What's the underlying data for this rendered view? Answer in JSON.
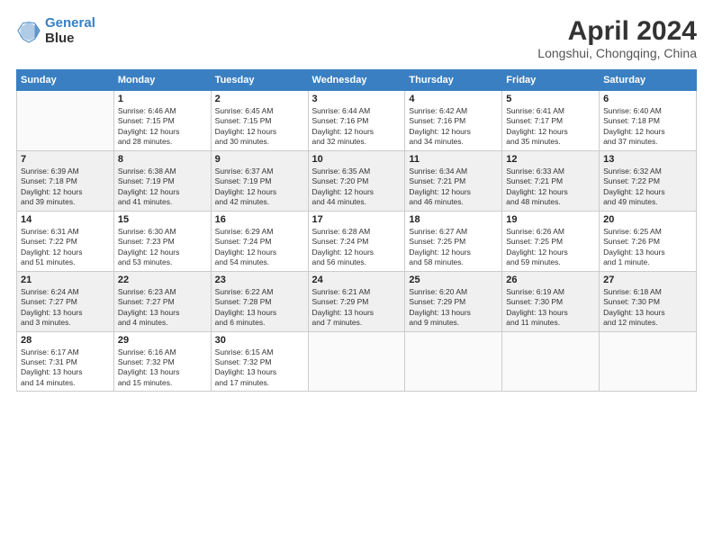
{
  "logo": {
    "line1": "General",
    "line2": "Blue"
  },
  "title": "April 2024",
  "location": "Longshui, Chongqing, China",
  "weekdays": [
    "Sunday",
    "Monday",
    "Tuesday",
    "Wednesday",
    "Thursday",
    "Friday",
    "Saturday"
  ],
  "weeks": [
    [
      {
        "day": "",
        "info": ""
      },
      {
        "day": "1",
        "info": "Sunrise: 6:46 AM\nSunset: 7:15 PM\nDaylight: 12 hours\nand 28 minutes."
      },
      {
        "day": "2",
        "info": "Sunrise: 6:45 AM\nSunset: 7:15 PM\nDaylight: 12 hours\nand 30 minutes."
      },
      {
        "day": "3",
        "info": "Sunrise: 6:44 AM\nSunset: 7:16 PM\nDaylight: 12 hours\nand 32 minutes."
      },
      {
        "day": "4",
        "info": "Sunrise: 6:42 AM\nSunset: 7:16 PM\nDaylight: 12 hours\nand 34 minutes."
      },
      {
        "day": "5",
        "info": "Sunrise: 6:41 AM\nSunset: 7:17 PM\nDaylight: 12 hours\nand 35 minutes."
      },
      {
        "day": "6",
        "info": "Sunrise: 6:40 AM\nSunset: 7:18 PM\nDaylight: 12 hours\nand 37 minutes."
      }
    ],
    [
      {
        "day": "7",
        "info": "Sunrise: 6:39 AM\nSunset: 7:18 PM\nDaylight: 12 hours\nand 39 minutes."
      },
      {
        "day": "8",
        "info": "Sunrise: 6:38 AM\nSunset: 7:19 PM\nDaylight: 12 hours\nand 41 minutes."
      },
      {
        "day": "9",
        "info": "Sunrise: 6:37 AM\nSunset: 7:19 PM\nDaylight: 12 hours\nand 42 minutes."
      },
      {
        "day": "10",
        "info": "Sunrise: 6:35 AM\nSunset: 7:20 PM\nDaylight: 12 hours\nand 44 minutes."
      },
      {
        "day": "11",
        "info": "Sunrise: 6:34 AM\nSunset: 7:21 PM\nDaylight: 12 hours\nand 46 minutes."
      },
      {
        "day": "12",
        "info": "Sunrise: 6:33 AM\nSunset: 7:21 PM\nDaylight: 12 hours\nand 48 minutes."
      },
      {
        "day": "13",
        "info": "Sunrise: 6:32 AM\nSunset: 7:22 PM\nDaylight: 12 hours\nand 49 minutes."
      }
    ],
    [
      {
        "day": "14",
        "info": "Sunrise: 6:31 AM\nSunset: 7:22 PM\nDaylight: 12 hours\nand 51 minutes."
      },
      {
        "day": "15",
        "info": "Sunrise: 6:30 AM\nSunset: 7:23 PM\nDaylight: 12 hours\nand 53 minutes."
      },
      {
        "day": "16",
        "info": "Sunrise: 6:29 AM\nSunset: 7:24 PM\nDaylight: 12 hours\nand 54 minutes."
      },
      {
        "day": "17",
        "info": "Sunrise: 6:28 AM\nSunset: 7:24 PM\nDaylight: 12 hours\nand 56 minutes."
      },
      {
        "day": "18",
        "info": "Sunrise: 6:27 AM\nSunset: 7:25 PM\nDaylight: 12 hours\nand 58 minutes."
      },
      {
        "day": "19",
        "info": "Sunrise: 6:26 AM\nSunset: 7:25 PM\nDaylight: 12 hours\nand 59 minutes."
      },
      {
        "day": "20",
        "info": "Sunrise: 6:25 AM\nSunset: 7:26 PM\nDaylight: 13 hours\nand 1 minute."
      }
    ],
    [
      {
        "day": "21",
        "info": "Sunrise: 6:24 AM\nSunset: 7:27 PM\nDaylight: 13 hours\nand 3 minutes."
      },
      {
        "day": "22",
        "info": "Sunrise: 6:23 AM\nSunset: 7:27 PM\nDaylight: 13 hours\nand 4 minutes."
      },
      {
        "day": "23",
        "info": "Sunrise: 6:22 AM\nSunset: 7:28 PM\nDaylight: 13 hours\nand 6 minutes."
      },
      {
        "day": "24",
        "info": "Sunrise: 6:21 AM\nSunset: 7:29 PM\nDaylight: 13 hours\nand 7 minutes."
      },
      {
        "day": "25",
        "info": "Sunrise: 6:20 AM\nSunset: 7:29 PM\nDaylight: 13 hours\nand 9 minutes."
      },
      {
        "day": "26",
        "info": "Sunrise: 6:19 AM\nSunset: 7:30 PM\nDaylight: 13 hours\nand 11 minutes."
      },
      {
        "day": "27",
        "info": "Sunrise: 6:18 AM\nSunset: 7:30 PM\nDaylight: 13 hours\nand 12 minutes."
      }
    ],
    [
      {
        "day": "28",
        "info": "Sunrise: 6:17 AM\nSunset: 7:31 PM\nDaylight: 13 hours\nand 14 minutes."
      },
      {
        "day": "29",
        "info": "Sunrise: 6:16 AM\nSunset: 7:32 PM\nDaylight: 13 hours\nand 15 minutes."
      },
      {
        "day": "30",
        "info": "Sunrise: 6:15 AM\nSunset: 7:32 PM\nDaylight: 13 hours\nand 17 minutes."
      },
      {
        "day": "",
        "info": ""
      },
      {
        "day": "",
        "info": ""
      },
      {
        "day": "",
        "info": ""
      },
      {
        "day": "",
        "info": ""
      }
    ]
  ]
}
